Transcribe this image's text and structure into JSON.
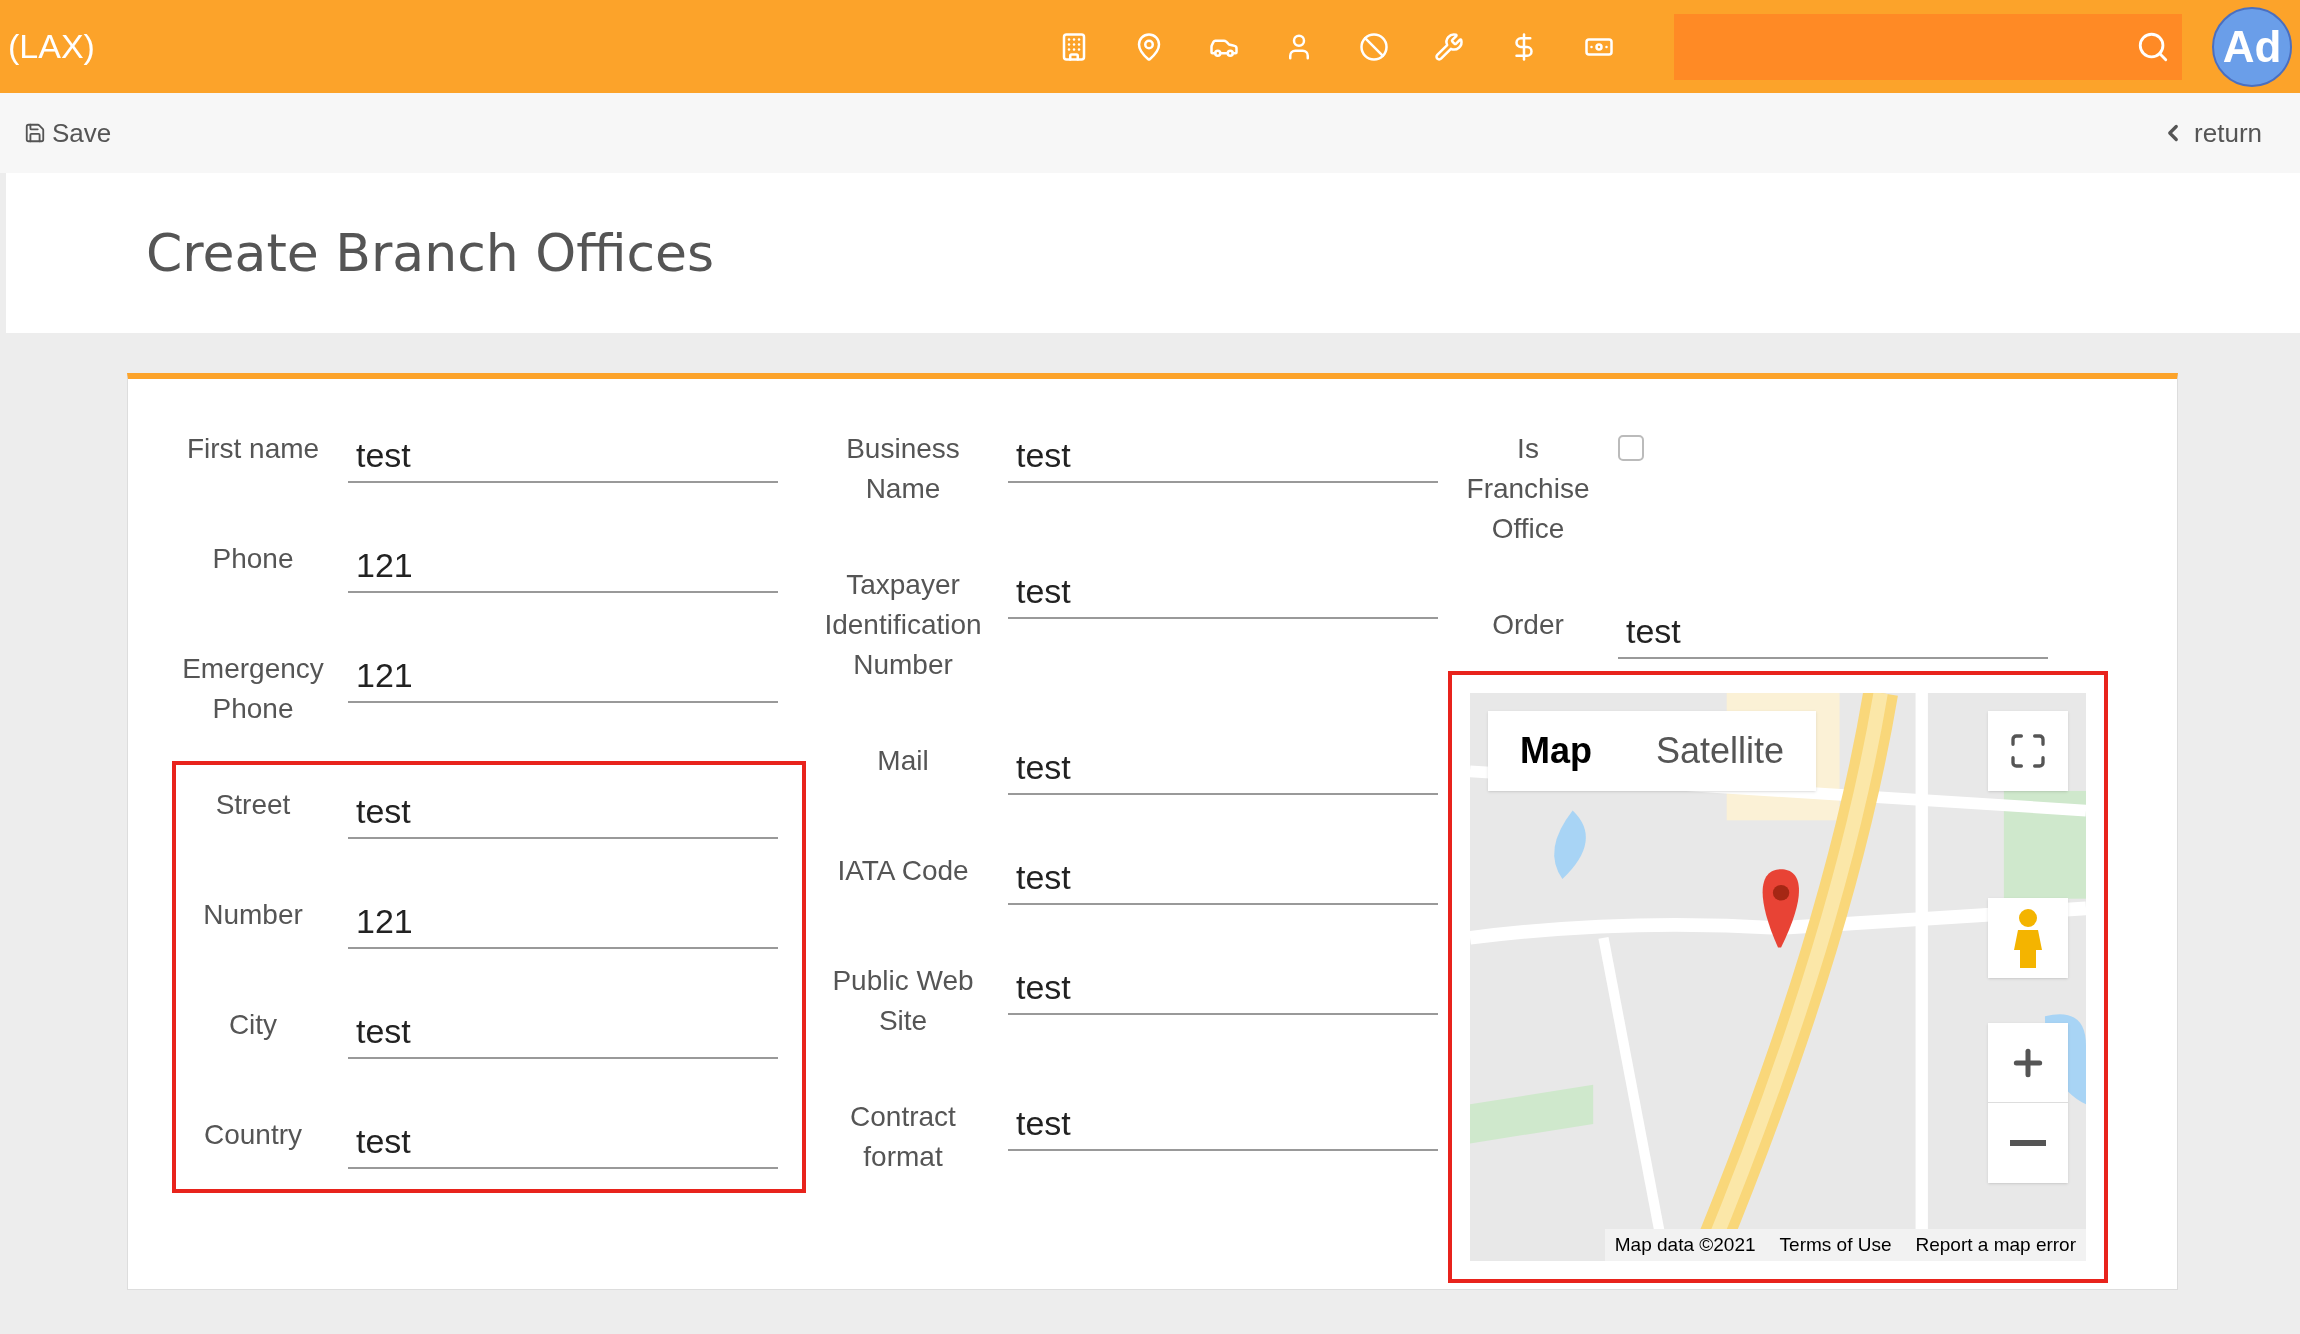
{
  "header": {
    "title": "(LAX)",
    "avatar": "Ad"
  },
  "toolbar": {
    "save": "Save",
    "return": "return"
  },
  "page_title": "Create Branch Offices",
  "columns": [
    {
      "groups": [
        {
          "highlighted": false,
          "fields": [
            {
              "kind": "text",
              "label": "First name",
              "value": "test"
            },
            {
              "kind": "text",
              "label": "Phone",
              "value": "121"
            },
            {
              "kind": "text",
              "label": "Emergency Phone",
              "value": "121"
            }
          ]
        },
        {
          "highlighted": true,
          "fields": [
            {
              "kind": "text",
              "label": "Street",
              "value": "test"
            },
            {
              "kind": "text",
              "label": "Number",
              "value": "121"
            },
            {
              "kind": "text",
              "label": "City",
              "value": "test"
            },
            {
              "kind": "text",
              "label": "Country",
              "value": "test"
            }
          ]
        }
      ]
    },
    {
      "groups": [
        {
          "highlighted": false,
          "fields": [
            {
              "kind": "text",
              "label": "Business Name",
              "value": "test"
            },
            {
              "kind": "text",
              "label": "Taxpayer Identification Number",
              "value": "test"
            },
            {
              "kind": "text",
              "label": "Mail",
              "value": "test"
            },
            {
              "kind": "text",
              "label": "IATA Code",
              "value": "test"
            },
            {
              "kind": "text",
              "label": "Public Web Site",
              "value": "test"
            },
            {
              "kind": "text",
              "label": "Contract format",
              "value": "test"
            }
          ]
        }
      ]
    },
    {
      "groups": [
        {
          "highlighted": false,
          "fields": [
            {
              "kind": "checkbox",
              "label": "Is Franchise Office",
              "checked": false
            },
            {
              "kind": "text",
              "label": "Order",
              "value": "test"
            }
          ]
        }
      ]
    }
  ],
  "map": {
    "highlighted": true,
    "tabs": [
      {
        "label": "Map",
        "selected": true
      },
      {
        "label": "Satellite",
        "selected": false
      }
    ],
    "attribution": [
      "Map data ©2021",
      "Terms of Use",
      "Report a map error"
    ]
  }
}
